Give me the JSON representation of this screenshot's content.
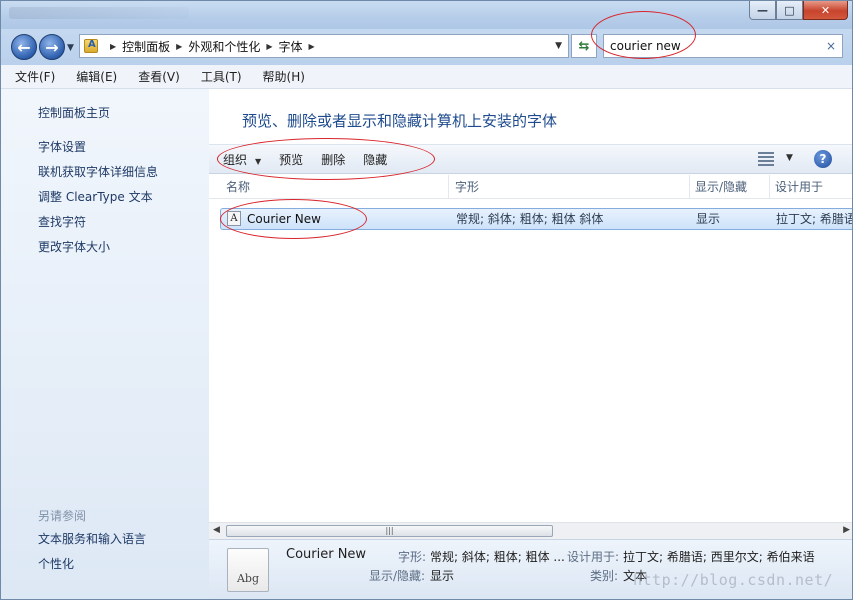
{
  "window": {
    "buttons": {
      "minimize": "—",
      "maximize": "□",
      "close": "✕"
    }
  },
  "nav": {
    "breadcrumb": [
      "控制面板",
      "外观和个性化",
      "字体"
    ],
    "separator": "▶",
    "refresh_icon": "refresh-icon",
    "search": {
      "value": "courier new",
      "clear": "×"
    }
  },
  "menubar": [
    "文件(F)",
    "编辑(E)",
    "查看(V)",
    "工具(T)",
    "帮助(H)"
  ],
  "sidebar": {
    "home": "控制面板主页",
    "items": [
      "字体设置",
      "联机获取字体详细信息",
      "调整 ClearType 文本",
      "查找字符",
      "更改字体大小"
    ],
    "see_also_title": "另请参阅",
    "see_also": [
      "文本服务和输入语言",
      "个性化"
    ]
  },
  "main": {
    "title": "预览、删除或者显示和隐藏计算机上安装的字体",
    "commands": {
      "organize": "组织",
      "preview": "预览",
      "delete": "删除",
      "hide": "隐藏"
    },
    "columns": [
      "名称",
      "字形",
      "显示/隐藏",
      "设计用于"
    ],
    "rows": [
      {
        "name": "Courier New",
        "styles": "常规; 斜体; 粗体; 粗体 斜体",
        "visibility": "显示",
        "designed_for": "拉丁文; 希腊语"
      }
    ]
  },
  "details": {
    "icon_text": "Abg",
    "name": "Courier New",
    "styles_label": "字形:",
    "styles_value": "常规; 斜体; 粗体; 粗体 ...",
    "designed_label": "设计用于:",
    "designed_value": "拉丁文; 希腊语; 西里尔文; 希伯来语",
    "visibility_label": "显示/隐藏:",
    "visibility_value": "显示",
    "category_label": "类别:",
    "category_value": "文本"
  },
  "watermark": "http://blog.csdn.net/",
  "colors": {
    "accent": "#1e4b8e",
    "annotation": "#d8242a",
    "selection": "#cde2fa"
  }
}
